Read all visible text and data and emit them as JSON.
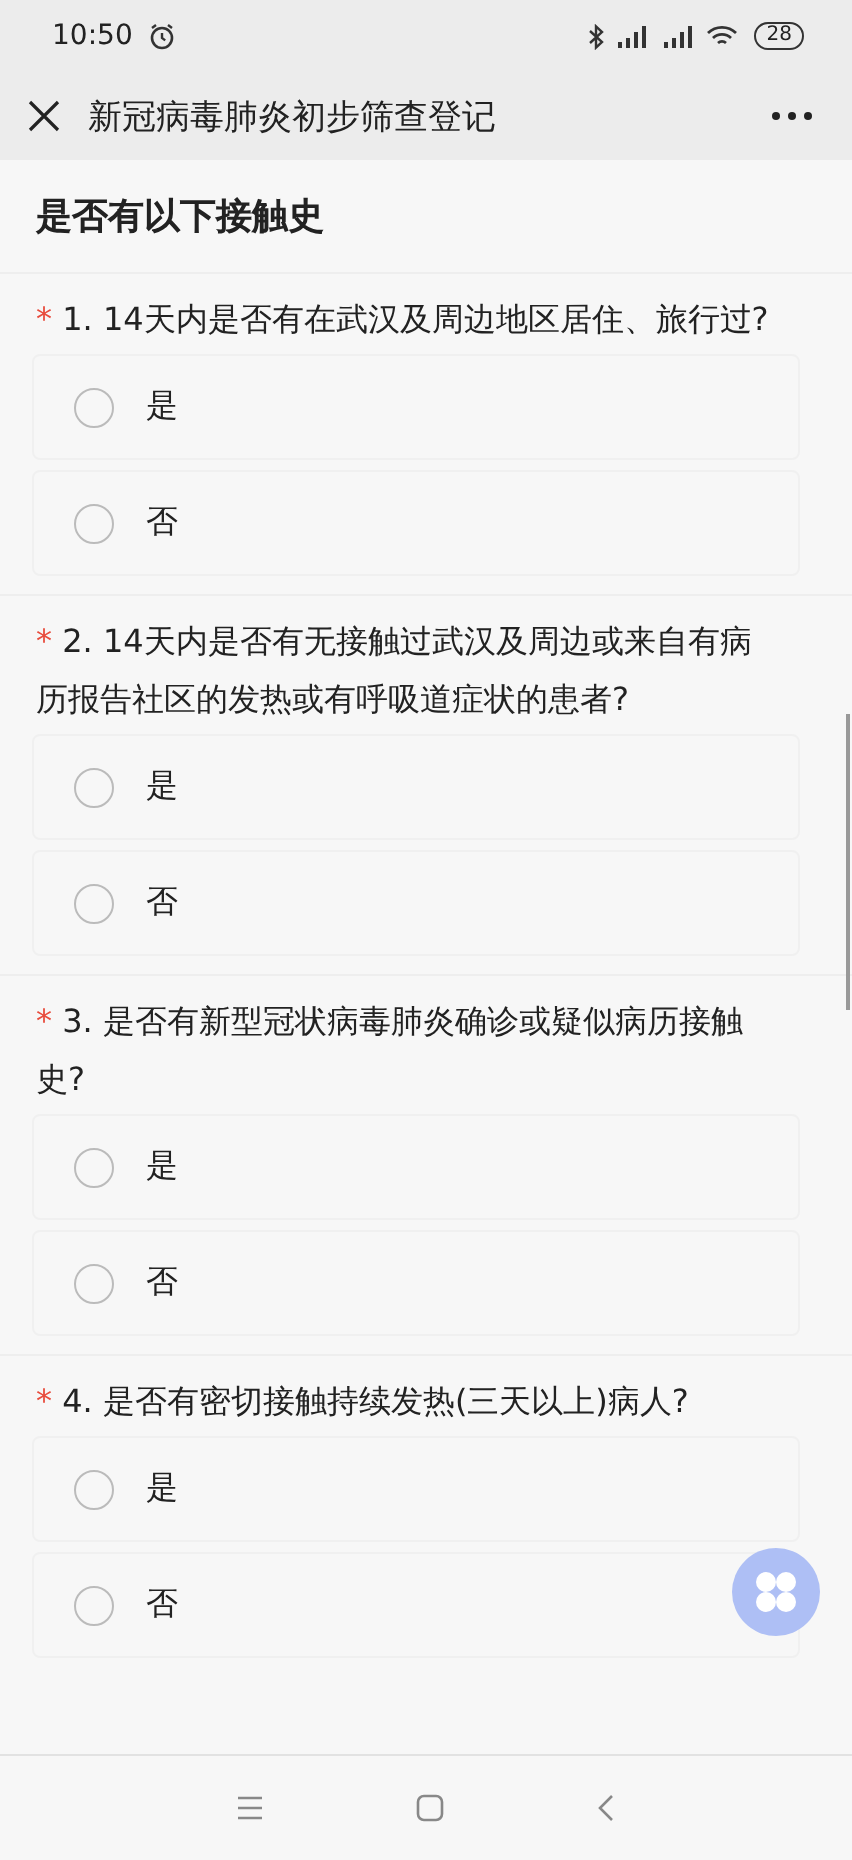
{
  "status_bar": {
    "time": "10:50",
    "battery": "28"
  },
  "title_bar": {
    "title": "新冠病毒肺炎初步筛查登记"
  },
  "section": {
    "title": "是否有以下接触史"
  },
  "questions": [
    {
      "marker": "*",
      "number": "1.",
      "text": "14天内是否有在武汉及周边地区居住、旅行过?",
      "options": [
        {
          "label": "是",
          "selected": false
        },
        {
          "label": "否",
          "selected": false
        }
      ]
    },
    {
      "marker": "*",
      "number": "2.",
      "text": "14天内是否有无接触过武汉及周边或来自有病历报告社区的发热或有呼吸道症状的患者?",
      "options": [
        {
          "label": "是",
          "selected": false
        },
        {
          "label": "否",
          "selected": false
        }
      ]
    },
    {
      "marker": "*",
      "number": "3.",
      "text": "是否有新型冠状病毒肺炎确诊或疑似病历接触史?",
      "options": [
        {
          "label": "是",
          "selected": false
        },
        {
          "label": "否",
          "selected": false
        }
      ]
    },
    {
      "marker": "*",
      "number": "4.",
      "text": "是否有密切接触持续发热(三天以上)病人?",
      "options": [
        {
          "label": "是",
          "selected": false
        },
        {
          "label": "否",
          "selected": false
        }
      ]
    }
  ]
}
